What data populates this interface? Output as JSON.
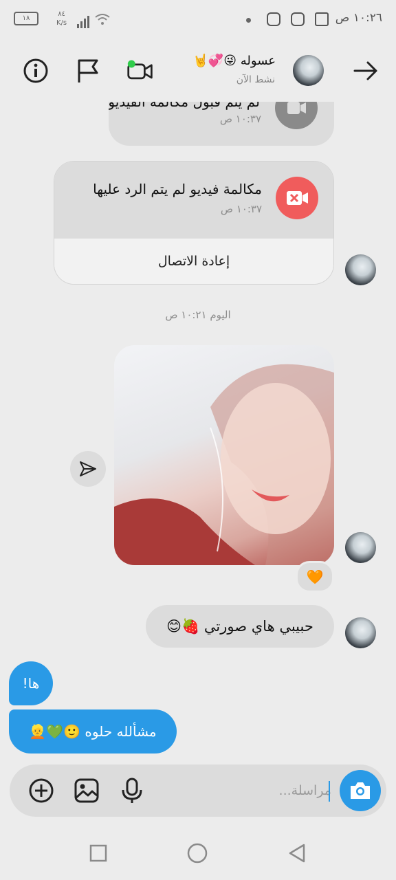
{
  "status_bar": {
    "time": "١٠:٢٦ ص",
    "network_speed_value": "٨٤",
    "network_speed_unit": "K/s",
    "battery": "١٨"
  },
  "header": {
    "contact_name": "عسوله 😜💞🤘",
    "status": "نشط الآن",
    "icons": [
      "arrow-right-icon",
      "video-camera-icon",
      "flag-icon",
      "info-icon"
    ]
  },
  "messages": {
    "call1": {
      "title": "لم يتم قبول مكالمة الفيديو",
      "time": "١٠:٣٧ ص"
    },
    "call2": {
      "title": "مكالمة فيديو لم يتم الرد عليها",
      "time": "١٠:٣٧ ص",
      "redial": "إعادة الاتصال"
    },
    "day_label": "اليوم ١٠:٢١ ص",
    "reaction": "🧡",
    "incoming_text": "حبيبي هاي صورتي 🍓😊",
    "outgoing_1": "ها!",
    "outgoing_2": "مشألله حلوه 🙂💚👱"
  },
  "composer": {
    "placeholder": "مراسلة...",
    "icons": [
      "camera-icon",
      "microphone-icon",
      "gallery-icon",
      "plus-icon"
    ]
  },
  "colors": {
    "accent": "#2a9ae6",
    "missed_call": "#f05c5c",
    "background": "#ececec",
    "bubble_gray": "#dcdcdc",
    "online_dot": "#2fcc4a"
  }
}
